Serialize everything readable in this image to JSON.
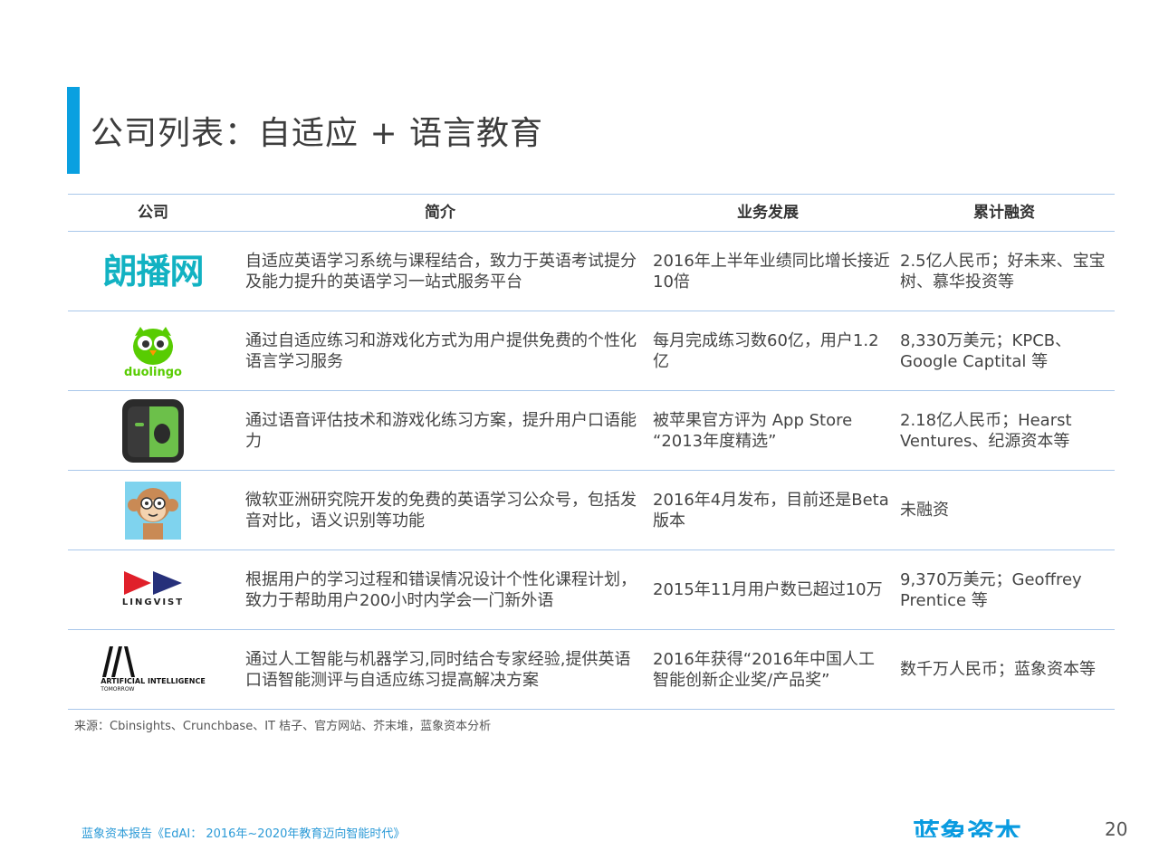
{
  "title": "公司列表：自适应 + 语言教育",
  "table": {
    "headers": [
      "公司",
      "简介",
      "业务发展",
      "累计融资"
    ],
    "rows": [
      {
        "logo_icon": "langbo-logo",
        "logo_text": "朗播网",
        "intro": "自适应英语学习系统与课程结合，致力于英语考试提分及能力提升的英语学习一站式服务平台",
        "development": "2016年上半年业绩同比增长接近10倍",
        "funding": "2.5亿人民币；好未来、宝宝树、慕华投资等"
      },
      {
        "logo_icon": "duolingo-owl-logo",
        "logo_text": "duolingo",
        "intro": "通过自适应练习和游戏化方式为用户提供免费的个性化语言学习服务",
        "development": "每月完成练习数60亿，用户1.2亿",
        "funding": "8,330万美元；KPCB、Google Captital 等"
      },
      {
        "logo_icon": "speech-app-logo",
        "logo_text": "",
        "intro": "通过语音评估技术和游戏化练习方案，提升用户口语能力",
        "development": "被苹果官方评为 App Store “2013年度精选”",
        "funding": "2.18亿人民币；Hearst Ventures、纪源资本等"
      },
      {
        "logo_icon": "monkey-logo",
        "logo_text": "",
        "intro": "微软亚洲研究院开发的免费的英语学习公众号，包括发音对比，语义识别等功能",
        "development": "2016年4月发布，目前还是Beta 版本",
        "funding": "未融资"
      },
      {
        "logo_icon": "lingvist-logo",
        "logo_text": "LINGVIST",
        "intro": "根据用户的学习过程和错误情况设计个性化课程计划，致力于帮助用户200小时内学会一门新外语",
        "development": "2015年11月用户数已超过10万",
        "funding": "9,370万美元；Geoffrey Prentice 等"
      },
      {
        "logo_icon": "ai-tomorrow-logo",
        "logo_text": "ARTIFICIAL INTELLIGENCE",
        "logo_subtext": "TOMORROW",
        "intro": "通过人工智能与机器学习,同时结合专家经验,提供英语口语智能测评与自适应练习提高解决方案",
        "development": "2016年获得“2016年中国人工智能创新企业奖/产品奖”",
        "funding": "数千万人民币；蓝象资本等"
      }
    ]
  },
  "source": "来源：Cbinsights、Crunchbase、IT 桔子、官方网站、芥末堆，蓝象资本分析",
  "footer": {
    "report": "蓝象资本报告《EdAI： 2016年~2020年教育迈向智能时代》",
    "brand": "蓝象资本",
    "page": "20"
  },
  "colors": {
    "accent": "#0aa0e0",
    "rule": "#a9c7ea",
    "langbo": "#12b2c2",
    "duolingo": "#58cc02"
  }
}
